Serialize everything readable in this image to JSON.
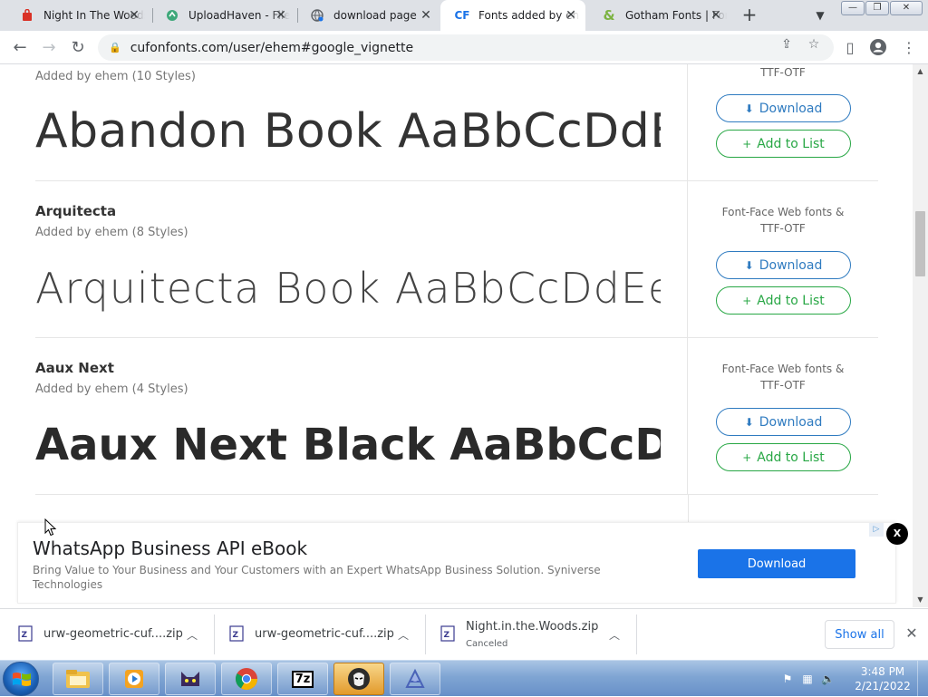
{
  "browser": {
    "tabs": [
      {
        "title": "Night In The Woods",
        "favicon": "red-bag-icon"
      },
      {
        "title": "UploadHaven - File",
        "favicon": "green-logo-icon"
      },
      {
        "title": "download page",
        "favicon": "globe-icon"
      },
      {
        "title": "Fonts added by ehem",
        "favicon": "cf-icon",
        "fav_text": "CF",
        "active": true
      },
      {
        "title": "Gotham Fonts | Font",
        "favicon": "ampersand-icon",
        "fav_text": "&"
      }
    ],
    "url": "cufonfonts.com/user/ehem#google_vignette",
    "new_tab": "+",
    "window_buttons": [
      "—",
      "❐",
      "✕"
    ]
  },
  "page": {
    "top_row": {
      "added_by": "Added by ehem (10 Styles)",
      "formats_tail": "TTF-OTF",
      "preview": "Abandon Book AaBbCcDdEe"
    },
    "fonts": [
      {
        "name": "Arquitecta",
        "added_by": "Added by ehem (8 Styles)",
        "formats_line1": "Font-Face Web fonts &",
        "formats_line2": "TTF-OTF",
        "preview": "Arquitecta Book AaBbCcDdEeFfGg"
      },
      {
        "name": "Aaux Next",
        "added_by": "Added by ehem (4 Styles)",
        "formats_line1": "Font-Face Web fonts &",
        "formats_line2": "TTF-OTF",
        "preview": "Aaux Next Black AaBbCcDdEe"
      }
    ],
    "buttons": {
      "download": "Download",
      "add_to_list": "Add to List"
    },
    "ad": {
      "title": "WhatsApp Business API eBook",
      "description": "Bring Value to Your Business and Your Customers with an Expert WhatsApp Business Solution. Syniverse Technologies",
      "button": "Download",
      "close": "X",
      "info_icon": "ad-choices-icon"
    }
  },
  "downloads": {
    "items": [
      {
        "name": "urw-geometric-cuf....zip",
        "status": ""
      },
      {
        "name": "urw-geometric-cuf....zip",
        "status": ""
      },
      {
        "name": "Night.in.the.Woods.zip",
        "status": "Canceled"
      }
    ],
    "show_all": "Show all"
  },
  "taskbar": {
    "apps": [
      "explorer-icon",
      "media-player-icon",
      "cat-app-icon",
      "chrome-icon",
      "7zip-icon",
      "hacker-app-icon",
      "blender-like-icon"
    ],
    "apps_text": {
      "7zip": "7z"
    },
    "time": "3:48 PM",
    "date": "2/21/2022"
  }
}
